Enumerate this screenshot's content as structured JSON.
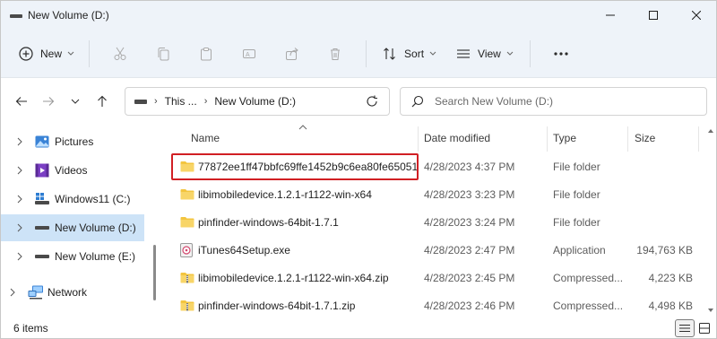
{
  "window": {
    "title": "New Volume (D:)"
  },
  "commandbar": {
    "new_label": "New",
    "sort_label": "Sort",
    "view_label": "View",
    "more_label": "•••"
  },
  "address": {
    "crumbs": [
      "This ...",
      "New Volume (D:)"
    ],
    "search_placeholder": "Search New Volume (D:)"
  },
  "nav": {
    "items": [
      {
        "label": "Pictures",
        "icon": "pictures-icon"
      },
      {
        "label": "Videos",
        "icon": "videos-icon"
      },
      {
        "label": "Windows11 (C:)",
        "icon": "windows-drive-icon"
      },
      {
        "label": "New Volume (D:)",
        "icon": "drive-icon",
        "selected": true
      },
      {
        "label": "New Volume (E:)",
        "icon": "drive-icon"
      },
      {
        "label": "Network",
        "icon": "network-icon"
      }
    ]
  },
  "columns": {
    "name": "Name",
    "date": "Date modified",
    "type": "Type",
    "size": "Size"
  },
  "files": [
    {
      "name": "77872ee1ff47bbfc69ffe1452b9c6ea80fe65051",
      "date": "4/28/2023 4:37 PM",
      "type": "File folder",
      "size": "",
      "icon": "folder-icon"
    },
    {
      "name": "libimobiledevice.1.2.1-r1122-win-x64",
      "date": "4/28/2023 3:23 PM",
      "type": "File folder",
      "size": "",
      "icon": "folder-icon"
    },
    {
      "name": "pinfinder-windows-64bit-1.7.1",
      "date": "4/28/2023 3:24 PM",
      "type": "File folder",
      "size": "",
      "icon": "folder-icon"
    },
    {
      "name": "iTunes64Setup.exe",
      "date": "4/28/2023 2:47 PM",
      "type": "Application",
      "size": "194,763 KB",
      "icon": "installer-icon"
    },
    {
      "name": "libimobiledevice.1.2.1-r1122-win-x64.zip",
      "date": "4/28/2023 2:45 PM",
      "type": "Compressed...",
      "size": "4,223 KB",
      "icon": "zip-folder-icon"
    },
    {
      "name": "pinfinder-windows-64bit-1.7.1.zip",
      "date": "4/28/2023 2:46 PM",
      "type": "Compressed...",
      "size": "4,498 KB",
      "icon": "zip-folder-icon"
    }
  ],
  "status": {
    "item_count": "6 items"
  },
  "colors": {
    "selection": "#cde3f7",
    "highlight_border": "#d11f24",
    "folder": "#f3c53f",
    "chrome_bg": "#eef3f9"
  }
}
